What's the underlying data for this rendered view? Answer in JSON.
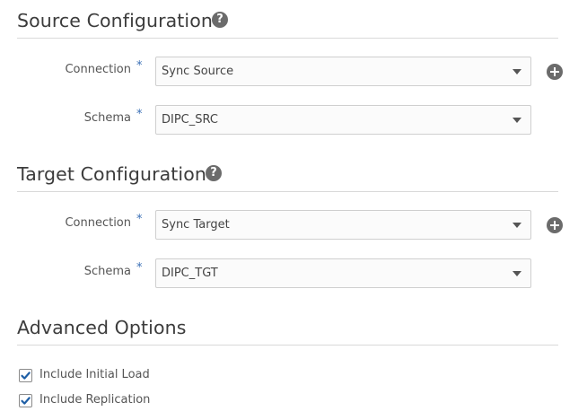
{
  "source": {
    "title": "Source Configuration",
    "help": "?",
    "connection": {
      "label": "Connection",
      "required": "*",
      "value": "Sync Source"
    },
    "schema": {
      "label": "Schema",
      "required": "*",
      "value": "DIPC_SRC"
    }
  },
  "target": {
    "title": "Target Configuration",
    "help": "?",
    "connection": {
      "label": "Connection",
      "required": "*",
      "value": "Sync Target"
    },
    "schema": {
      "label": "Schema",
      "required": "*",
      "value": "DIPC_TGT"
    }
  },
  "advanced": {
    "title": "Advanced Options",
    "options": [
      {
        "label": "Include Initial Load",
        "checked": true
      },
      {
        "label": "Include Replication",
        "checked": true
      }
    ]
  },
  "colors": {
    "accent": "#3a6fb5",
    "icon": "#6b6b6b",
    "checkmark": "#1f5fa6"
  }
}
